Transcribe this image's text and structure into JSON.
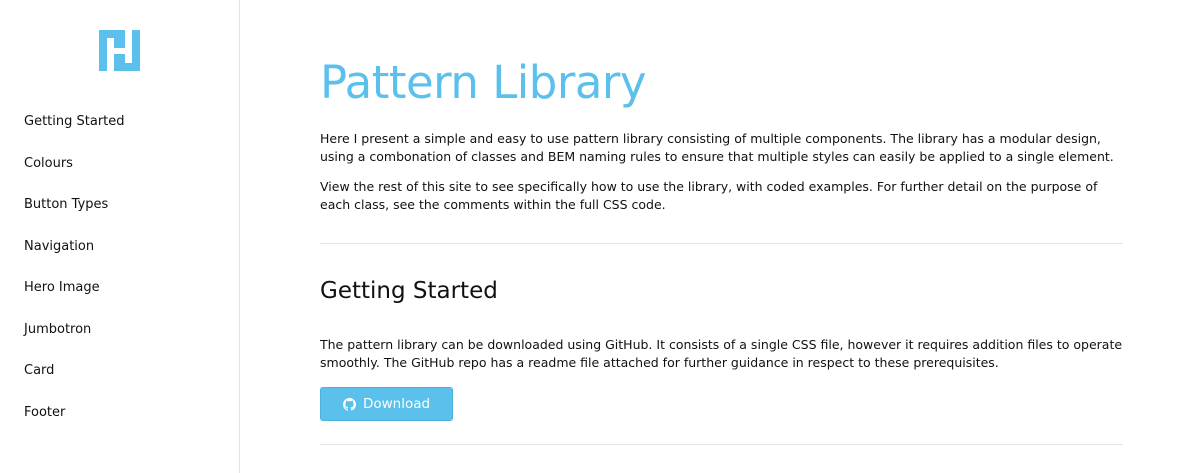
{
  "colors": {
    "accent": "#5bc0eb",
    "text": "#111111",
    "divider": "#e5e5e5"
  },
  "sidebar": {
    "logo_icon": "h-logo-icon",
    "items": [
      {
        "label": "Getting Started"
      },
      {
        "label": "Colours"
      },
      {
        "label": "Button Types"
      },
      {
        "label": "Navigation"
      },
      {
        "label": "Hero Image"
      },
      {
        "label": "Jumbotron"
      },
      {
        "label": "Card"
      },
      {
        "label": "Footer"
      }
    ]
  },
  "main": {
    "title": "Pattern Library",
    "intro_1": "Here I present a simple and easy to use pattern library consisting of multiple components. The library has a modular design, using a combonation of classes and BEM naming rules to ensure that multiple styles can easily be applied to a single element.",
    "intro_2": "View the rest of this site to see specifically how to use the library, with coded examples. For further detail on the purpose of each class, see the comments within the full CSS code.",
    "section": {
      "title": "Getting Started",
      "body": "The pattern library can be downloaded using GitHub. It consists of a single CSS file, however it requires addition files to operate smoothly. The GitHub repo has a readme file attached for further guidance in respect to these prerequisites.",
      "download_label": "Download",
      "download_icon": "github-icon"
    }
  }
}
